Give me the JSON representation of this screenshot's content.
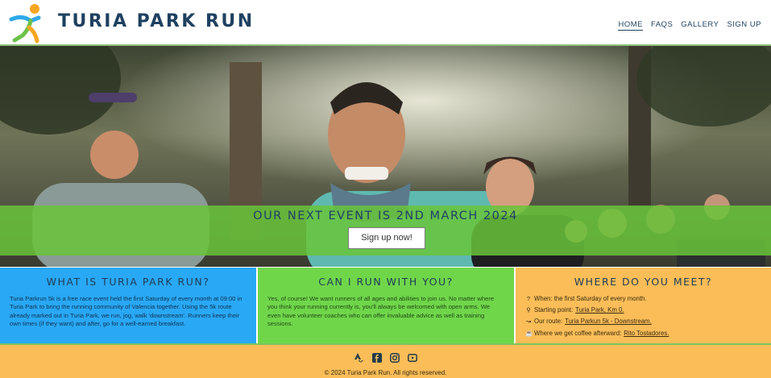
{
  "header": {
    "brand": "TURIA PARK RUN",
    "logo_icon": "runner-logo-icon",
    "nav": [
      {
        "label": "HOME",
        "active": true
      },
      {
        "label": "FAQS",
        "active": false
      },
      {
        "label": "GALLERY",
        "active": false
      },
      {
        "label": "SIGN UP",
        "active": false
      }
    ]
  },
  "hero": {
    "image": "runners-group-photo",
    "banner_title": "OUR NEXT EVENT IS 2ND MARCH 2024",
    "signup_button": "Sign up now!"
  },
  "panels": {
    "what": {
      "title": "WHAT IS TURIA PARK RUN?",
      "body": "Turia Parkrun 5k is a free race event held the first Saturday of every month at 09:00 in Turia Park to bring the running community of Valencia together. Using the 5k route already marked out in Turia Park, we run, jog, walk 'downstream'. Runners keep their own times (if they want) and after, go for a well-earned breakfast."
    },
    "can": {
      "title": "CAN I RUN WITH YOU?",
      "body": "Yes, of course! We want runners of all ages and abilities to join us. No matter where you think your running currently is, you'll always be welcomed with open arms. We even have volunteer coaches who can offer invaluable advice as well as training sessions."
    },
    "where": {
      "title": "WHERE DO YOU MEET?",
      "items": [
        {
          "icon": "question-icon",
          "text": "When: the first Saturday of every month.",
          "link": ""
        },
        {
          "icon": "map-pin-icon",
          "text": "Starting point: ",
          "link": "Turia Park, Km 0."
        },
        {
          "icon": "route-icon",
          "text": "Our route: ",
          "link": "Turia Parkun 5k - Downstream."
        },
        {
          "icon": "coffee-icon",
          "text": "Where we get coffee afterward: ",
          "link": "Rito Tostadores."
        }
      ]
    }
  },
  "footer": {
    "socials": [
      "strava-icon",
      "facebook-icon",
      "instagram-icon",
      "youtube-icon"
    ],
    "copyright": "© 2024 Turia Park Run. All rights reserved."
  },
  "colors": {
    "brand_navy": "#1f4160",
    "blue_panel": "#29a8f5",
    "green_panel": "#6fd64a",
    "orange_panel": "#fbbd58",
    "banner_green": "#68c43a"
  }
}
